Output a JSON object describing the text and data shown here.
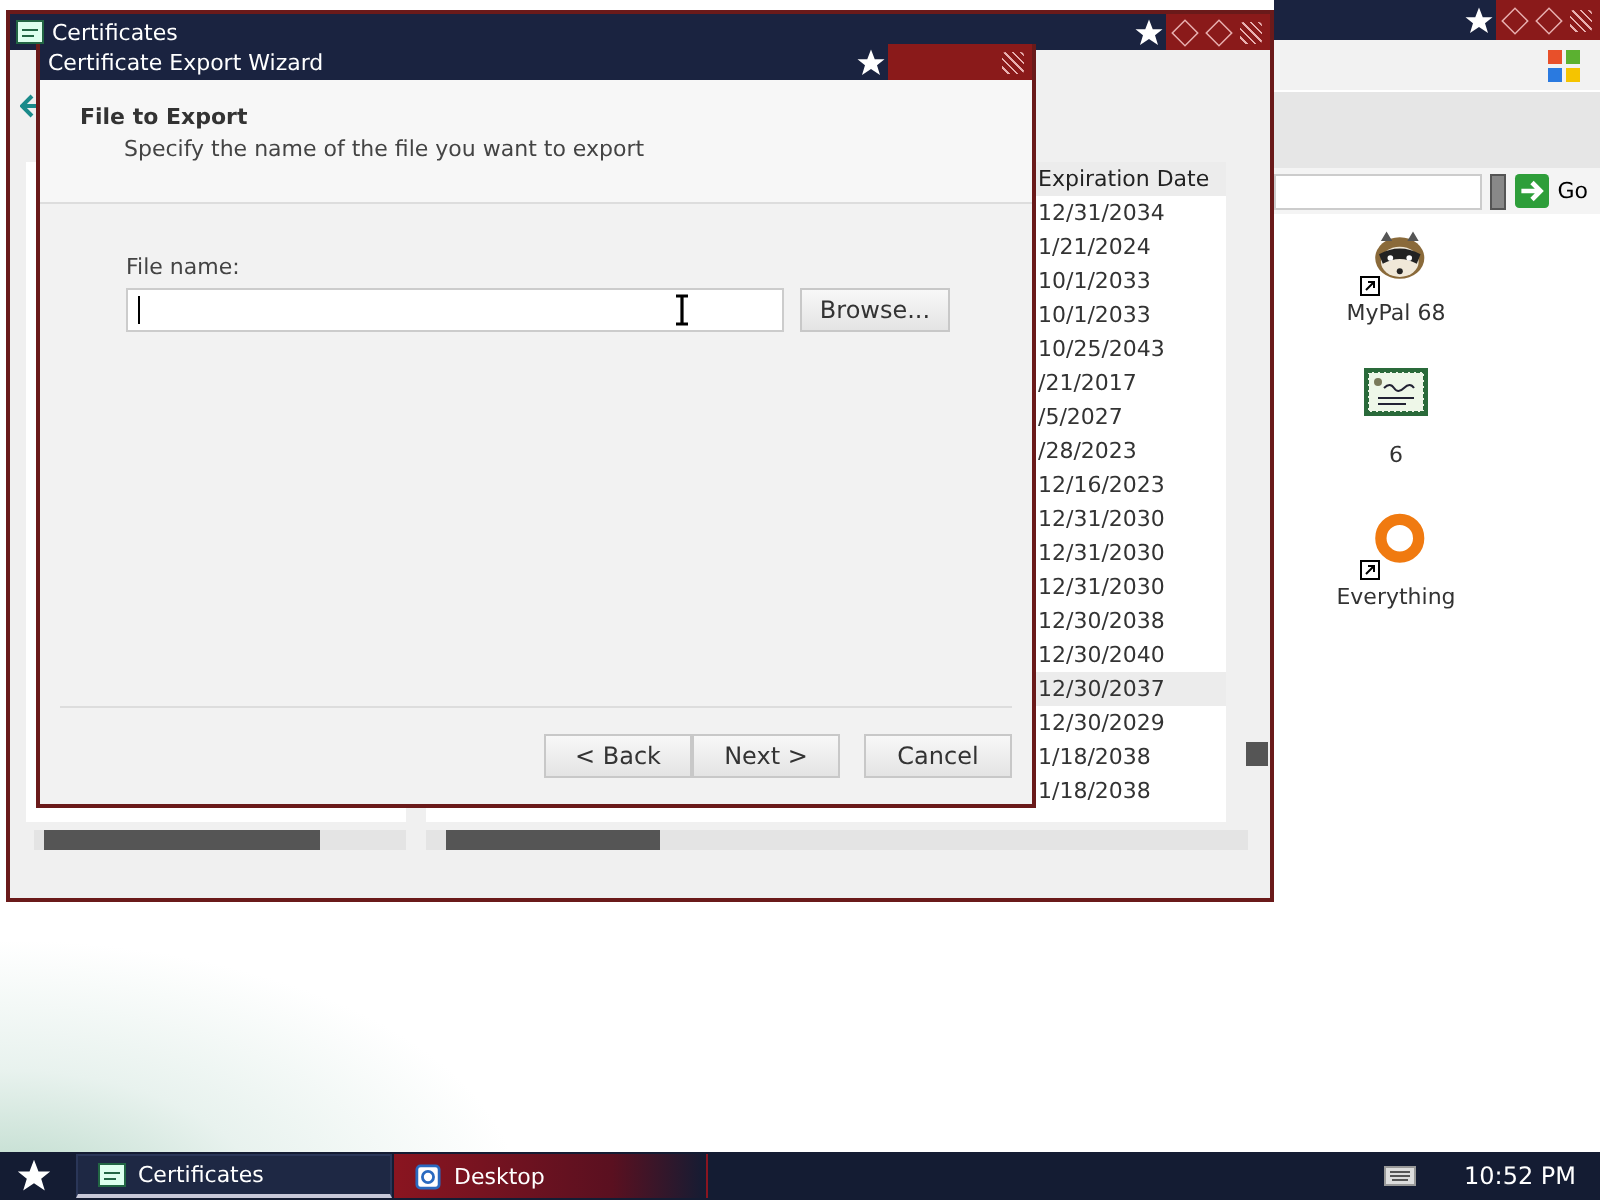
{
  "browser_window": {
    "go_button": "Go"
  },
  "desktop_icons": [
    {
      "kind": "raccoon",
      "label": "MyPal 68",
      "shortcut": true
    },
    {
      "kind": "certificate",
      "label": "6",
      "shortcut": false
    },
    {
      "kind": "ring",
      "label": "Everything",
      "shortcut": true
    }
  ],
  "certificates_window": {
    "title": "Certificates",
    "list": {
      "columns": [
        "Expiration Date"
      ],
      "rows": [
        {
          "expiration": "12/31/2034",
          "selected": false
        },
        {
          "expiration": "1/21/2024",
          "selected": false
        },
        {
          "expiration": "10/1/2033",
          "selected": false
        },
        {
          "expiration": "10/1/2033",
          "selected": false
        },
        {
          "expiration": "10/25/2043",
          "selected": false
        },
        {
          "expiration": "/21/2017",
          "selected": false
        },
        {
          "expiration": "/5/2027",
          "selected": false
        },
        {
          "expiration": "/28/2023",
          "selected": false
        },
        {
          "expiration": "12/16/2023",
          "selected": false
        },
        {
          "expiration": "12/31/2030",
          "selected": false
        },
        {
          "expiration": "12/31/2030",
          "selected": false
        },
        {
          "expiration": "12/31/2030",
          "selected": false
        },
        {
          "expiration": "12/30/2038",
          "selected": false
        },
        {
          "expiration": "12/30/2040",
          "selected": false
        },
        {
          "expiration": "12/30/2037",
          "selected": true
        },
        {
          "expiration": "12/30/2029",
          "selected": false
        },
        {
          "expiration": "1/18/2038",
          "selected": false
        },
        {
          "expiration": "1/18/2038",
          "selected": false
        }
      ]
    }
  },
  "wizard": {
    "title": "Certificate Export Wizard",
    "heading": "File to Export",
    "subtitle": "Specify the name of the file you want to export",
    "file_name": {
      "label": "File name:"
    },
    "browse_button": "Browse...",
    "buttons": [
      {
        "label": "< Back",
        "kind": "nav"
      },
      {
        "label": "Next >",
        "kind": "nav"
      },
      {
        "label": "Cancel",
        "kind": "cancel"
      }
    ]
  },
  "taskbar": {
    "tasks": [
      {
        "label": "Certificates",
        "kind": "certificates",
        "selected": true
      },
      {
        "label": "Desktop",
        "kind": "desktop",
        "selected": false
      }
    ],
    "clock": "10:52 PM"
  }
}
